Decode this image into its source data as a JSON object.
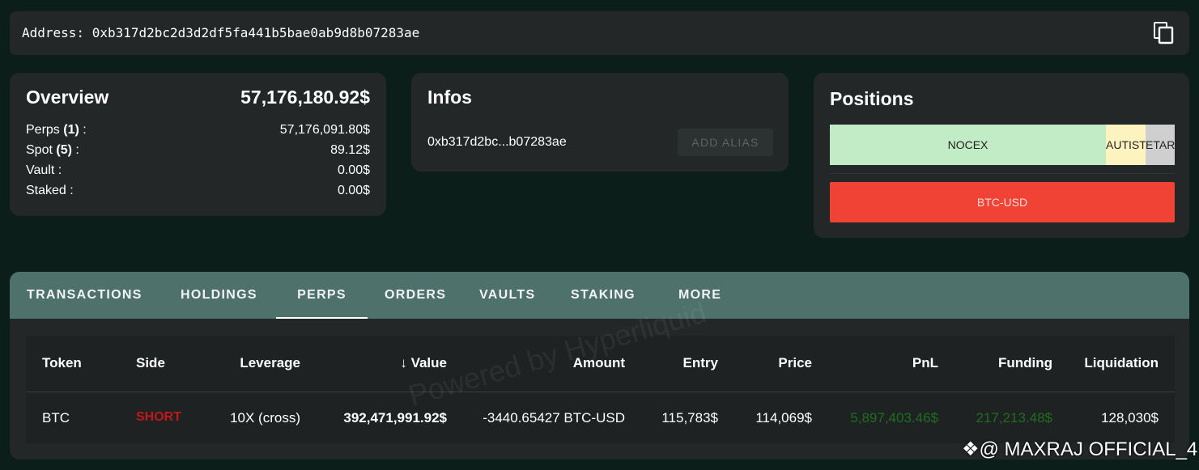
{
  "address": {
    "label": "Address: 0xb317d2bc2d3d2df5fa441b5bae0ab9d8b07283ae",
    "copy_icon": "copy-icon"
  },
  "overview": {
    "title": "Overview",
    "total": "57,176,180.92$",
    "rows": [
      {
        "label": "Perps",
        "count": "(1)",
        "suffix": " :",
        "value": "57,176,091.80$"
      },
      {
        "label": "Spot",
        "count": "(5)",
        "suffix": " :",
        "value": "89.12$"
      },
      {
        "label": "Vault :",
        "count": "",
        "suffix": "",
        "value": "0.00$"
      },
      {
        "label": "Staked :",
        "count": "",
        "suffix": "",
        "value": "0.00$"
      }
    ]
  },
  "infos": {
    "title": "Infos",
    "short_address": "0xb317d2bc...b07283ae",
    "add_alias": "ADD ALIAS"
  },
  "positions": {
    "title": "Positions",
    "spot": [
      {
        "label": "NOCEX",
        "color": "#c2ecc6"
      },
      {
        "label": "AUTIST",
        "color": "#fdf3bf"
      },
      {
        "label": "ETAR",
        "color": "#cfcfcf"
      }
    ],
    "perps": [
      {
        "label": "BTC-USD",
        "color": "#f14236"
      }
    ]
  },
  "tabs": [
    "TRANSACTIONS",
    "HOLDINGS",
    "PERPS",
    "ORDERS",
    "VAULTS",
    "STAKING",
    "MORE"
  ],
  "active_tab": "PERPS",
  "table": {
    "headers": [
      "Token",
      "Side",
      "Leverage",
      "Value",
      "Amount",
      "Entry",
      "Price",
      "PnL",
      "Funding",
      "Liquidation"
    ],
    "sort_icon": "arrow-down-icon",
    "rows": [
      [
        "BTC",
        "SHORT",
        "10X (cross)",
        "392,471,991.92$",
        "-3440.65427 BTC-USD",
        "115,783$",
        "114,069$",
        "5,897,403.46$",
        "217,213.48$",
        "128,030$"
      ]
    ]
  },
  "watermark": "Powered by Hyperliquid",
  "credit": "@ MAXRAJ OFFICIAL_4",
  "colors": {
    "background": "#0b1e19",
    "card": "#232727",
    "tabbar": "#4e716c",
    "short": "#c0181b",
    "positive": "#1f6e1f"
  }
}
